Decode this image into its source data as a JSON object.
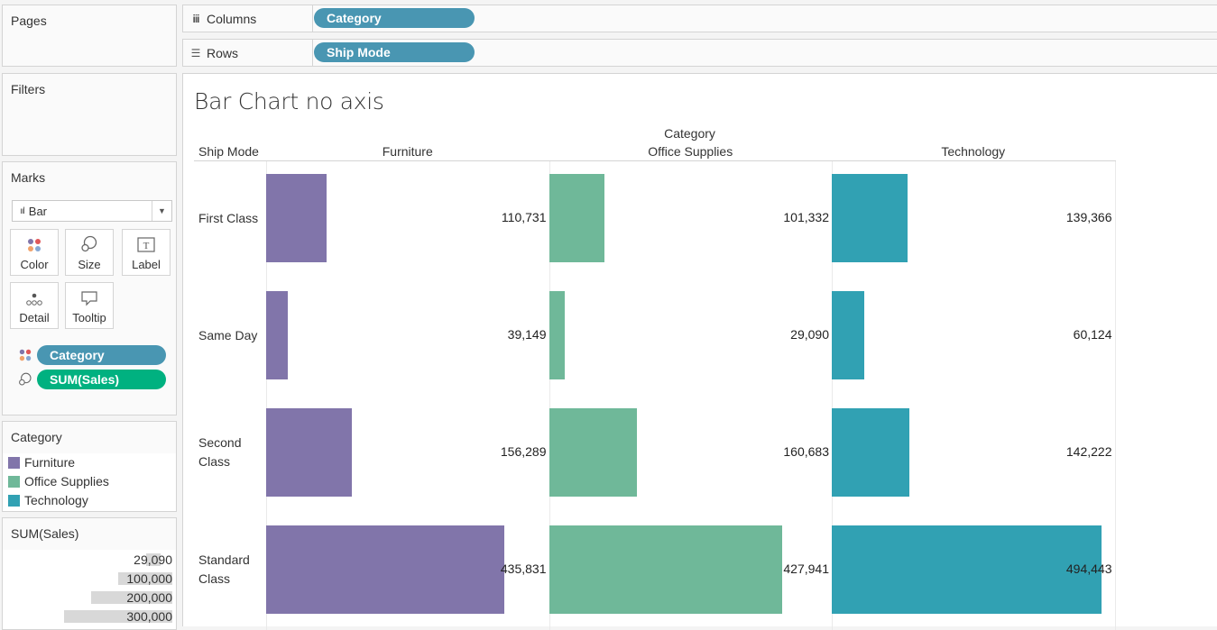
{
  "pages_card": {
    "title": "Pages"
  },
  "filters_card": {
    "title": "Filters"
  },
  "shelves": {
    "columns": {
      "icon": "columns-icon",
      "label": "Columns",
      "pill": "Category"
    },
    "rows": {
      "icon": "rows-icon",
      "label": "Rows",
      "pill": "Ship Mode"
    }
  },
  "marks": {
    "title": "Marks",
    "mark_type": "Bar",
    "buttons": [
      {
        "label": "Color",
        "icon": "color-icon"
      },
      {
        "label": "Size",
        "icon": "size-icon"
      },
      {
        "label": "Label",
        "icon": "label-icon"
      },
      {
        "label": "Detail",
        "icon": "detail-icon"
      },
      {
        "label": "Tooltip",
        "icon": "tooltip-icon"
      }
    ],
    "pills": [
      {
        "type": "color",
        "label": "Category"
      },
      {
        "type": "size",
        "label": "SUM(Sales)"
      }
    ]
  },
  "color_legend": {
    "title": "Category",
    "items": [
      {
        "label": "Furniture",
        "color": "#8175aa"
      },
      {
        "label": "Office Supplies",
        "color": "#6fb899"
      },
      {
        "label": "Technology",
        "color": "#31a1b3"
      }
    ]
  },
  "size_legend": {
    "title": "SUM(Sales)",
    "items": [
      {
        "label": "29,090",
        "value": 29090
      },
      {
        "label": "100,000",
        "value": 100000
      },
      {
        "label": "200,000",
        "value": 200000
      },
      {
        "label": "300,000",
        "value": 300000
      }
    ]
  },
  "chart_data": {
    "type": "bar",
    "title": "Bar Chart no axis",
    "orientation": "horizontal",
    "column_header_title": "Category",
    "row_header_title": "Ship Mode",
    "categories": [
      "First Class",
      "Same Day",
      "Second Class",
      "Standard Class"
    ],
    "category_display": [
      [
        "First Class"
      ],
      [
        "Same Day"
      ],
      [
        "Second",
        "Class"
      ],
      [
        "Standard",
        "Class"
      ]
    ],
    "series": [
      {
        "name": "Furniture",
        "color": "#8175aa",
        "values": [
          110731,
          39149,
          156289,
          435831
        ],
        "labels": [
          "110,731",
          "39,149",
          "156,289",
          "435,831"
        ]
      },
      {
        "name": "Office Supplies",
        "color": "#6fb899",
        "values": [
          101332,
          29090,
          160683,
          427941
        ],
        "labels": [
          "101,332",
          "29,090",
          "160,683",
          "427,941"
        ]
      },
      {
        "name": "Technology",
        "color": "#31a1b3",
        "values": [
          139366,
          60124,
          142222,
          494443
        ],
        "labels": [
          "139,366",
          "60,124",
          "142,222",
          "494,443"
        ]
      }
    ],
    "xlim": [
      0,
      518000
    ],
    "axis_visible": false,
    "grid": false
  }
}
